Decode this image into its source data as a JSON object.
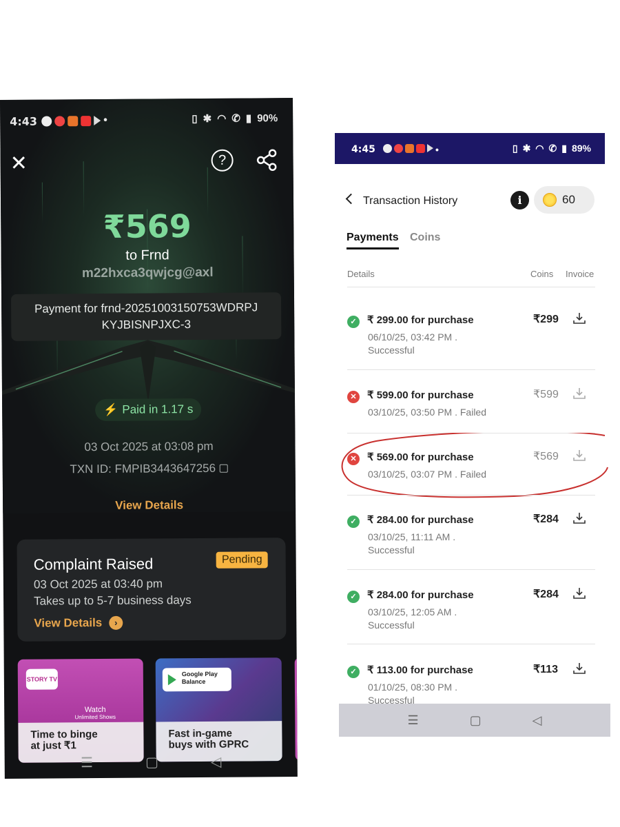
{
  "left": {
    "status_bar": {
      "time": "4:43",
      "battery": "90%",
      "dot": "•"
    },
    "amount": "₹569",
    "to": "to Frnd",
    "vpa": "m22hxca3qwjcg@axl",
    "note_line1": "Payment for frnd-20251003150753WDRPJ",
    "note_line2": "KYJBISNPJXC-3",
    "paid": "Paid in 1.17 s",
    "date": "03 Oct 2025 at 03:08 pm",
    "txn": "TXN ID: FMPIB3443647256",
    "view_details": "View Details",
    "complaint": {
      "title": "Complaint Raised",
      "badge": "Pending",
      "date": "03 Oct 2025 at 03:40 pm",
      "eta": "Takes up to 5-7 business days",
      "view_details": "View Details"
    },
    "promos": [
      {
        "logo": "STORY TV",
        "watch": "Watch",
        "watch_sub": "Unlimited Shows",
        "caption1": "Time to binge",
        "caption2": "at just ₹1"
      },
      {
        "logo_line1": "Google Play",
        "logo_line2": "Balance",
        "caption1": "Fast in-game",
        "caption2": "buys with GPRC"
      }
    ],
    "nav": [
      "☰",
      "▢",
      "◁"
    ]
  },
  "right": {
    "status_bar": {
      "time": "4:45",
      "battery": "89%",
      "dot": "•"
    },
    "title": "Transaction History",
    "info": "i",
    "coins": "60",
    "tabs": {
      "payments": "Payments",
      "coins": "Coins"
    },
    "columns": {
      "details": "Details",
      "coins": "Coins",
      "invoice": "Invoice"
    },
    "rows": [
      {
        "title": "₹ 299.00 for purchase",
        "meta": "06/10/25, 03:42 PM . Successful",
        "amount": "₹299",
        "status": "success"
      },
      {
        "title": "₹ 599.00 for purchase",
        "meta": "03/10/25, 03:50 PM . Failed",
        "amount": "₹599",
        "status": "failed"
      },
      {
        "title": "₹ 569.00 for purchase",
        "meta": "03/10/25, 03:07 PM . Failed",
        "amount": "₹569",
        "status": "failed"
      },
      {
        "title": "₹ 284.00 for purchase",
        "meta": "03/10/25, 11:11 AM . Successful",
        "amount": "₹284",
        "status": "success"
      },
      {
        "title": "₹ 284.00 for purchase",
        "meta": "03/10/25, 12:05 AM . Successful",
        "amount": "₹284",
        "status": "success"
      },
      {
        "title": "₹ 113.00 for purchase",
        "meta": "01/10/25, 08:30 PM . Successful",
        "amount": "₹113",
        "status": "success"
      }
    ],
    "nav": [
      "☰",
      "▢",
      "◁"
    ]
  },
  "colors": {
    "accent_green": "#7fd99a",
    "accent_orange": "#e8a64d",
    "status_bar_right": "#1c1766",
    "annotation_red": "#c8302e"
  }
}
